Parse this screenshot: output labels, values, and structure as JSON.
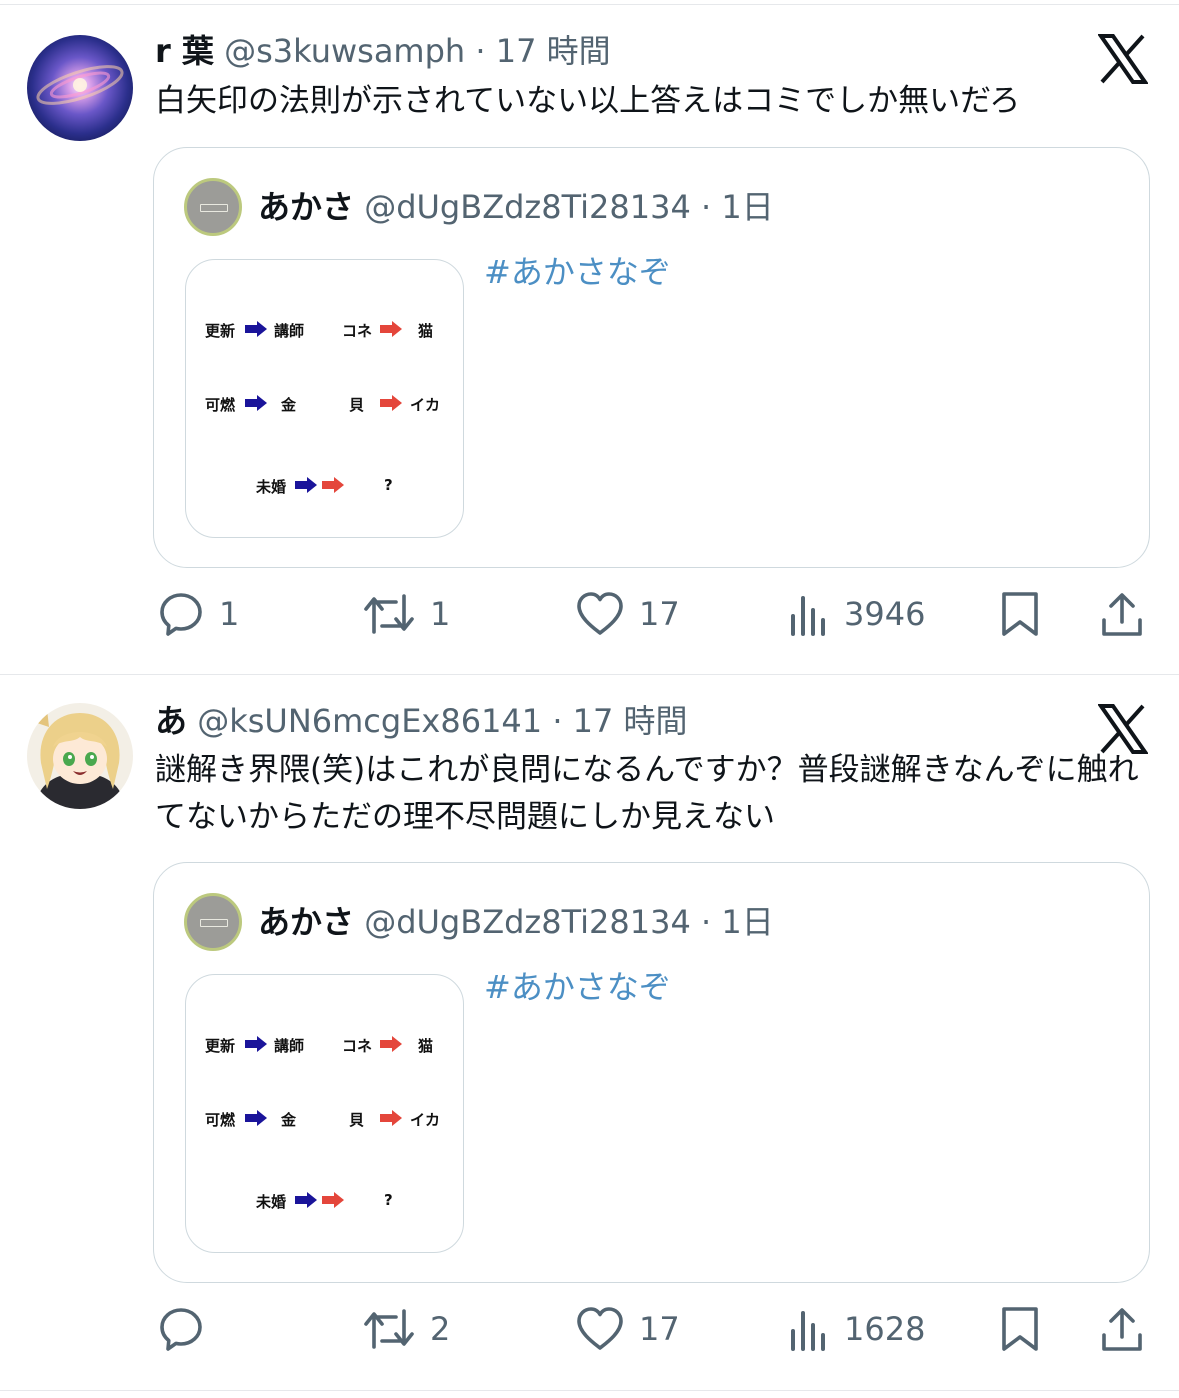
{
  "tweets": [
    {
      "name": "r 葉",
      "meta": "@s3kuwsamph · 17 時間",
      "text": "白矢印の法則が示されていない以上答えはコミでしか無いだろ",
      "quote": {
        "name": "あかさ",
        "meta": "@dUgBZdz8Ti28134 · 1日",
        "hashtag": "#あかさなぞ",
        "puzzle": {
          "r1_left_word": "更新",
          "r1_left_result": "講師",
          "r1_right_word": "コネ",
          "r1_right_result": "猫",
          "r2_left_word": "可燃",
          "r2_left_result": "金",
          "r2_right_word": "貝",
          "r2_right_result": "イカ",
          "r3_word": "未婚",
          "r3_result": "?"
        }
      },
      "actions": {
        "replies": "1",
        "retweets": "1",
        "likes": "17",
        "views": "3946"
      }
    },
    {
      "name": "あ",
      "meta": "@ksUN6mcgEx86141 · 17 時間",
      "text": "謎解き界隈(笑)はこれが良問になるんですか？普段謎解きなんぞに触れてないからただの理不尽問題にしか見えない",
      "quote": {
        "name": "あかさ",
        "meta": "@dUgBZdz8Ti28134 · 1日",
        "hashtag": "#あかさなぞ",
        "puzzle": {
          "r1_left_word": "更新",
          "r1_left_result": "講師",
          "r1_right_word": "コネ",
          "r1_right_result": "猫",
          "r2_left_word": "可燃",
          "r2_left_result": "金",
          "r2_right_word": "貝",
          "r2_right_result": "イカ",
          "r3_word": "未婚",
          "r3_result": "?"
        }
      },
      "actions": {
        "replies": "",
        "retweets": "2",
        "likes": "17",
        "views": "1628"
      }
    }
  ],
  "colors": {
    "text": "#0f1419",
    "meta": "#536471",
    "hashtag": "#4c8fc4",
    "border": "#cfd9de",
    "arrow_blue": "#1a149a",
    "arrow_red": "#e4463b"
  },
  "icons": [
    "x-logo-icon",
    "reply-icon",
    "retweet-icon",
    "like-icon",
    "views-icon",
    "bookmark-icon",
    "share-icon"
  ]
}
